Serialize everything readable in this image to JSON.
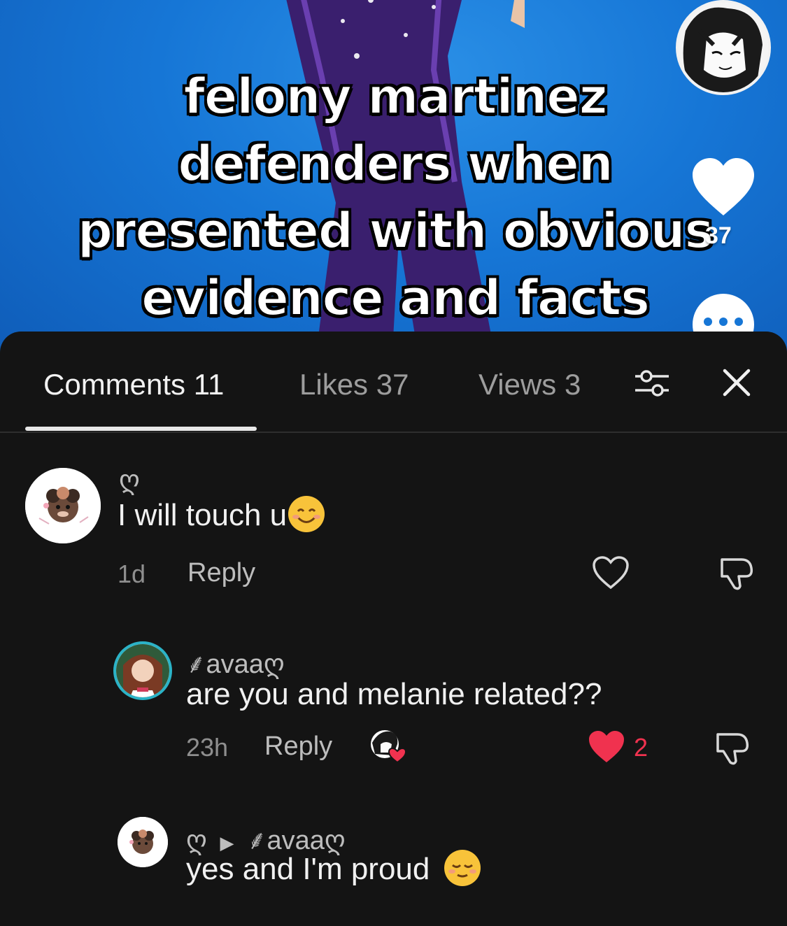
{
  "video": {
    "caption_lines": [
      "felony martinez",
      "defenders when",
      "presented with obvious",
      "evidence and facts"
    ],
    "like_count": "37"
  },
  "tabs": {
    "comments": "Comments 11",
    "likes": "Likes 37",
    "views": "Views 3"
  },
  "comments": [
    {
      "name": "ღ",
      "text": "I will touch u",
      "emoji": "smiling-face-icon",
      "time": "1d",
      "reply_label": "Reply"
    },
    {
      "name": "⸙avaaღ",
      "text": "are you and melanie related??",
      "time": "23h",
      "reply_label": "Reply",
      "like_count": "2"
    },
    {
      "name": "ღ",
      "reply_to": "⸙avaaღ",
      "text": "yes and I'm proud",
      "emoji": "relieved-face-icon"
    }
  ],
  "colors": {
    "accent_red": "#f0324f",
    "sheet_bg": "#141414",
    "video_blue": "#1676d6"
  }
}
